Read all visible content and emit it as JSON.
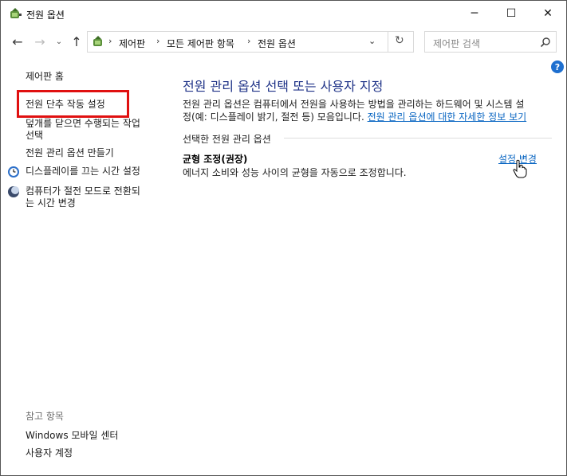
{
  "window": {
    "title": "전원 옵션",
    "controls": {
      "minimize": "─",
      "maximize": "☐",
      "close": "✕"
    }
  },
  "address": {
    "crumbs": [
      "제어판",
      "모든 제어판 항목",
      "전원 옵션"
    ]
  },
  "search": {
    "placeholder": "제어판 검색"
  },
  "help_label": "?",
  "sidebar": {
    "home": "제어판 홈",
    "items": [
      {
        "label": "전원 단추 작동 설정"
      },
      {
        "label_line1": "덮개를 닫으면 수행되는 작업",
        "label_line2": "선택"
      },
      {
        "label": "전원 관리 옵션 만들기"
      },
      {
        "label": "디스플레이를 끄는 시간 설정"
      },
      {
        "label_line1": "컴퓨터가 절전 모드로 전환되",
        "label_line2": "는 시간 변경"
      }
    ],
    "see_also_title": "참고 항목",
    "see_also": [
      "Windows 모바일 센터",
      "사용자 계정"
    ]
  },
  "main": {
    "title": "전원 관리 옵션 선택 또는 사용자 지정",
    "desc_line1": "전원 관리 옵션은 컴퓨터에서 전원을 사용하는 방법을 관리하는 하드웨어 및 시스템 설",
    "desc_line2_prefix": "정(예: 디스플레이 밝기, 절전 등) 모음입니다.",
    "desc_link": "전원 관리 옵션에 대한 자세한 정보 보기",
    "group_title": "선택한 전원 관리 옵션",
    "plan": {
      "name": "균형 조정(권장)",
      "description": "에너지 소비와 성능 사이의 균형을 자동으로 조정합니다.",
      "change_link": "설정 변경"
    }
  },
  "colors": {
    "accent_link": "#0a66c2",
    "title_blue": "#1e3287",
    "highlight_red": "#e01010"
  }
}
